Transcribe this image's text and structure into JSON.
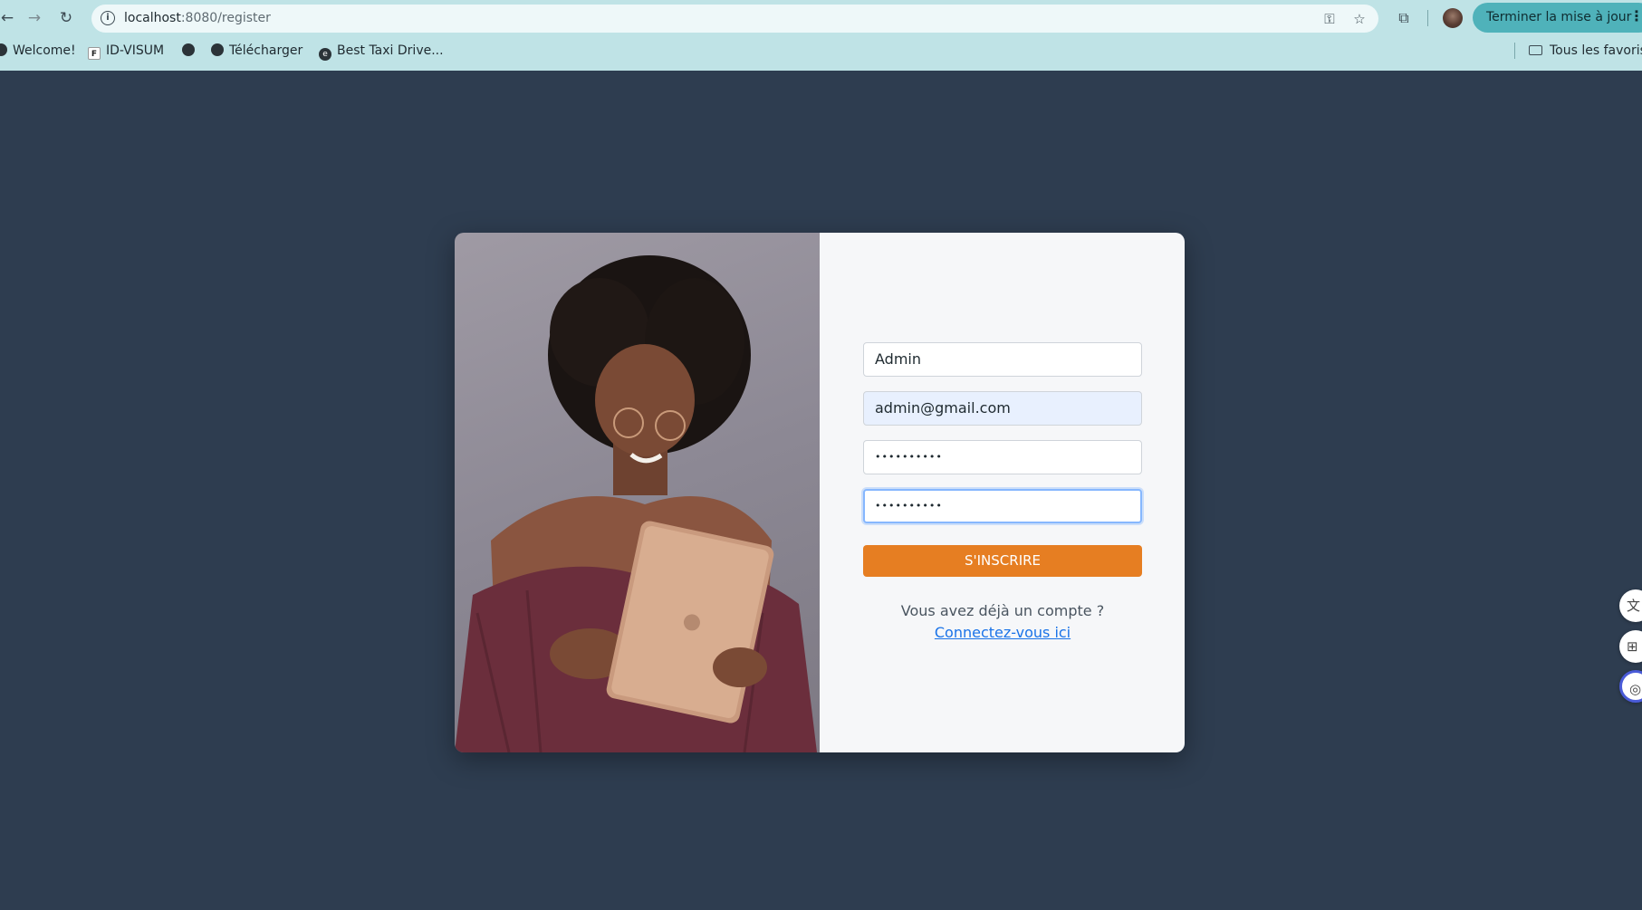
{
  "browser": {
    "url_host": "localhost",
    "url_path": ":8080/register",
    "update_button": "Terminer la mise à jour",
    "bookmarks": [
      {
        "label": "Welcome!",
        "icon": "globe-icon"
      },
      {
        "label": "ID-VISUM",
        "icon": "f-logo-icon"
      },
      {
        "label": "",
        "icon": "globe-icon"
      },
      {
        "label": "Télécharger",
        "icon": "globe-icon"
      },
      {
        "label": "Best Taxi Drive...",
        "icon": "e-logo-icon"
      }
    ],
    "all_bookmarks": "Tous les favoris"
  },
  "form": {
    "username_value": "Admin",
    "email_value": "admin@gmail.com",
    "password_value": "••••••••••",
    "confirm_value": "••••••••••",
    "submit_label": "S'INSCRIRE",
    "signin_prompt": "Vous avez déjà un compte ?",
    "signin_link": "Connectez-vous ici"
  },
  "colors": {
    "page_bg": "#2e3d50",
    "accent": "#e67e22",
    "link": "#1a73e8",
    "chrome": "#bfe3e6"
  }
}
